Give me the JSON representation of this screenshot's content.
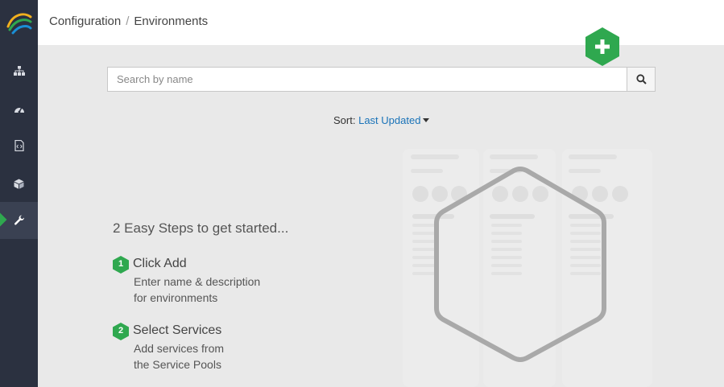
{
  "header": {
    "breadcrumb": [
      "Configuration",
      "Environments"
    ],
    "separator": "/"
  },
  "sidebar": {
    "items": [
      {
        "icon": "sitemap-icon",
        "active": false
      },
      {
        "icon": "dashboard-icon",
        "active": false
      },
      {
        "icon": "file-code-icon",
        "active": false
      },
      {
        "icon": "cube-icon",
        "active": false
      },
      {
        "icon": "wrench-icon",
        "active": true
      }
    ]
  },
  "add_button": {
    "icon": "plus-icon",
    "color": "#2fa84f"
  },
  "search": {
    "placeholder": "Search by name",
    "value": ""
  },
  "sort": {
    "label": "Sort:",
    "value": "Last Updated"
  },
  "getting_started": {
    "title": "2 Easy Steps to get started...",
    "steps": [
      {
        "number": "1",
        "title": "Click Add",
        "desc_line1": "Enter name & description",
        "desc_line2": "for environments"
      },
      {
        "number": "2",
        "title": "Select Services",
        "desc_line1": "Add services from",
        "desc_line2": "the Service Pools"
      }
    ]
  },
  "colors": {
    "sidebar": "#2b3140",
    "accent": "#2fa84f",
    "link": "#1a73b8"
  }
}
